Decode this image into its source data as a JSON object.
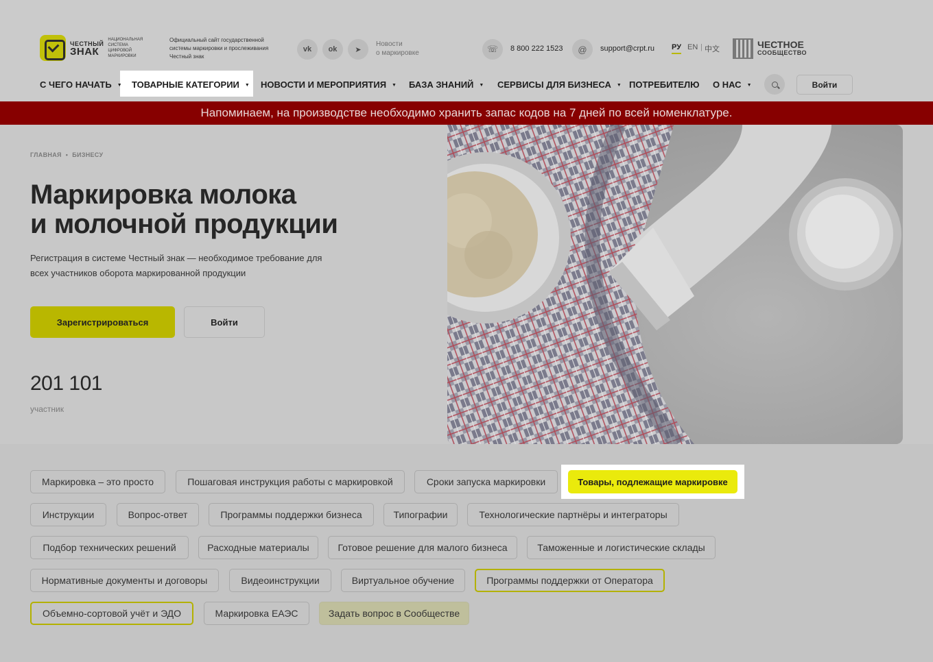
{
  "header": {
    "logo": {
      "line1": "ЧЕСТНЫЙ",
      "line2": "ЗНАК",
      "sub": "национальная система цифровой маркировки"
    },
    "site_desc": "Официальный сайт государственной системы маркировки и прослеживания Честный знак",
    "social": [
      "vk-icon",
      "ok-icon",
      "telegram-icon"
    ],
    "social_glyphs": [
      "vk",
      "ok",
      "➤"
    ],
    "news_link_line1": "Новости",
    "news_link_line2": "о маркировке",
    "phone": "8 800 222 1523",
    "email": "support@crpt.ru",
    "langs": [
      "РУ",
      "EN",
      "中文"
    ],
    "community": {
      "line1": "ЧЕСТНОЕ",
      "line2": "СООБЩЕСТВО"
    }
  },
  "nav": {
    "items": [
      {
        "label": "С ЧЕГО НАЧАТЬ",
        "caret": true
      },
      {
        "label": "ТОВАРНЫЕ КАТЕГОРИИ",
        "caret": true
      },
      {
        "label": "НОВОСТИ И МЕРОПРИЯТИЯ",
        "caret": true
      },
      {
        "label": "БАЗА ЗНАНИЙ",
        "caret": true
      },
      {
        "label": "СЕРВИСЫ ДЛЯ БИЗНЕСА",
        "caret": true
      },
      {
        "label": "ПОТРЕБИТЕЛЮ",
        "caret": false
      },
      {
        "label": "О НАС",
        "caret": true
      }
    ],
    "login": "Войти"
  },
  "banner": "Напоминаем, на производстве необходимо хранить запас кодов на 7 дней по всей номенклатуре.",
  "hero": {
    "breadcrumbs": [
      "ГЛАВНАЯ",
      "БИЗНЕСУ"
    ],
    "title_line1": "Маркировка молока",
    "title_line2": "и молочной продукции",
    "lead": "Регистрация в системе Честный знак — необходимое требование для всех участников оборота маркированной продукции",
    "register": "Зарегистрироваться",
    "login": "Войти",
    "stat_value": "201 101",
    "stat_label": "участник"
  },
  "tags": [
    "Маркировка – это просто",
    "Пошаговая инструкция работы с маркировкой",
    "Сроки запуска маркировки",
    "Товары, подлежащие маркировке",
    "Инструкции",
    "Вопрос-ответ",
    "Программы поддержки бизнеса",
    "Типографии",
    "Технологические партнёры и интеграторы",
    "Подбор технических решений",
    "Расходные материалы",
    "Готовое решение для малого бизнеса",
    "Таможенные и логистические склады",
    "Нормативные документы и договоры",
    "Видеоинструкции",
    "Виртуальное обучение",
    "Программы поддержки от Оператора",
    "Объемно-сортовой учёт и ЭДО",
    "Маркировка ЕАЭС",
    "Задать вопрос в Сообществе"
  ],
  "colors": {
    "accent": "#eaea0c",
    "banner": "#870000",
    "button": "#b9b700"
  }
}
